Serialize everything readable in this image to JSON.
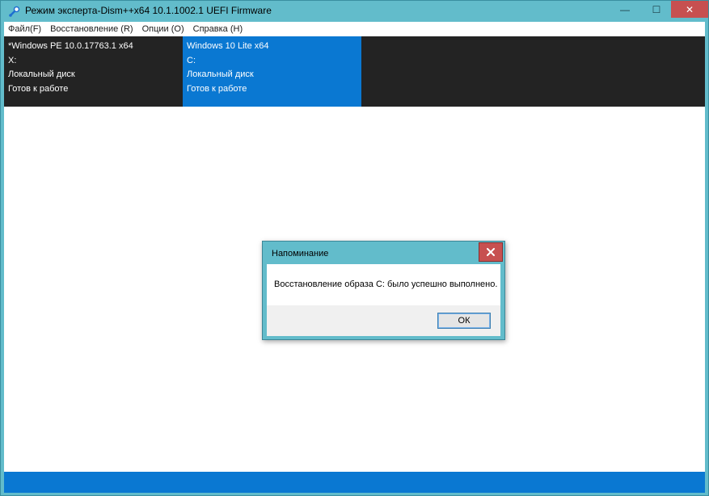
{
  "window": {
    "title": "Режим эксперта-Dism++x64 10.1.1002.1 UEFI Firmware",
    "minimize_glyph": "—",
    "maximize_glyph": "☐",
    "close_glyph": "✕",
    "icons": {
      "app": "dism-app-icon",
      "minimize": "minimize-icon",
      "maximize": "maximize-icon",
      "close": "close-icon"
    }
  },
  "menu": {
    "items": [
      "Файл(F)",
      "Восстановление (R)",
      "Опции (O)",
      "Справка (H)"
    ]
  },
  "sessions": [
    {
      "name": "*Windows PE 10.0.17763.1 x64",
      "drive": "X:",
      "disk_type": "Локальный диск",
      "status": "Готов к работе",
      "selected": false
    },
    {
      "name": "Windows 10 Lite x64",
      "drive": "C:",
      "disk_type": "Локальный диск",
      "status": "Готов к работе",
      "selected": true
    }
  ],
  "dialog": {
    "title": "Напоминание",
    "message": "Восстановление образа C: было успешно выполнено.",
    "ok_label": "ОК",
    "close_glyph": "✕"
  },
  "colors": {
    "titlebar": "#62bccb",
    "accent": "#0a78d2",
    "session_bg": "#232323",
    "close_red": "#c75050"
  }
}
